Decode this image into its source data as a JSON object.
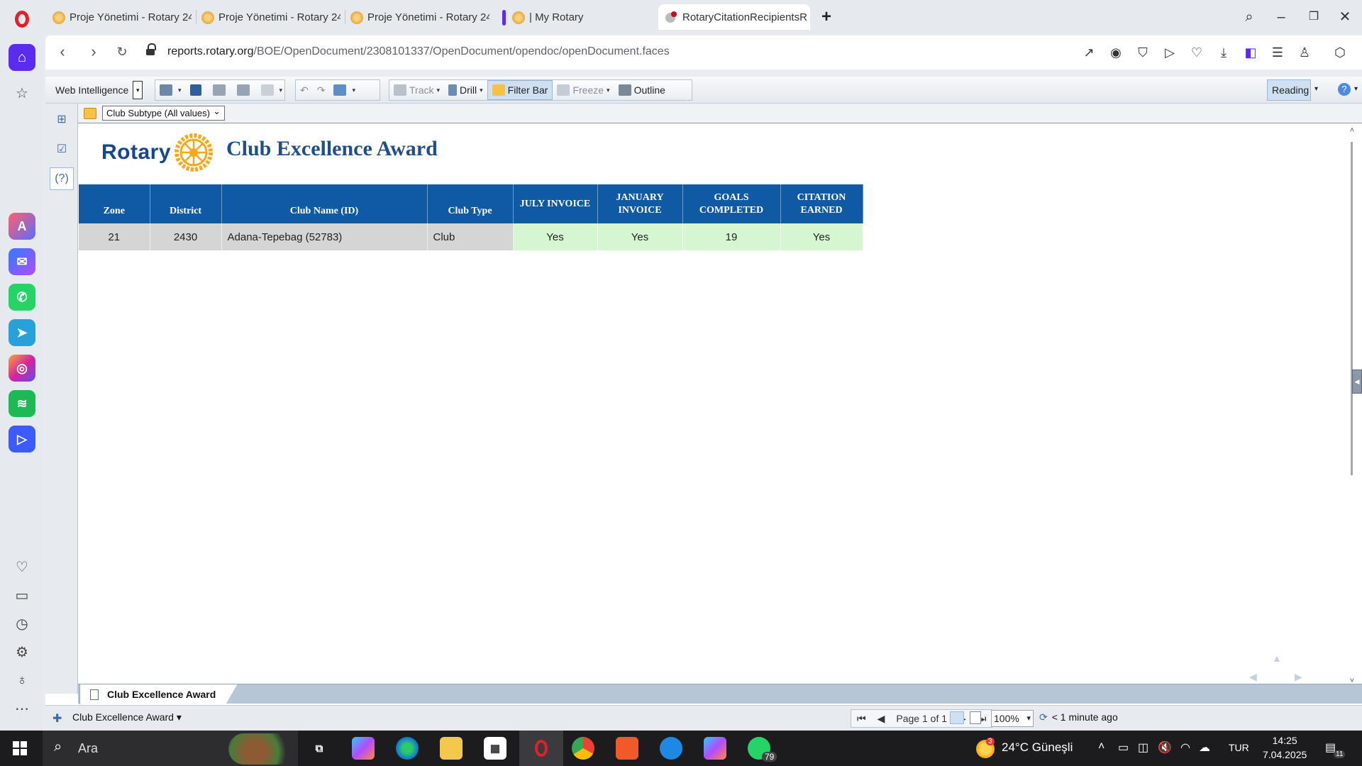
{
  "browser": {
    "tabs": [
      {
        "title": "Proje Yönetimi - Rotary 24"
      },
      {
        "title": "Proje Yönetimi - Rotary 24"
      },
      {
        "title": "Proje Yönetimi - Rotary 24"
      },
      {
        "title": "| My Rotary"
      },
      {
        "title": "RotaryCitationRecipientsR"
      }
    ],
    "url_host": "reports.rotary.org",
    "url_path": "/BOE/OpenDocument/2308101337/OpenDocument/opendoc/openDocument.faces"
  },
  "toolbar": {
    "app_name": "Web Intelligence",
    "track": "Track",
    "drill": "Drill",
    "filter_bar": "Filter Bar",
    "freeze": "Freeze",
    "outline": "Outline",
    "mode": "Reading"
  },
  "filter": {
    "label": "Club Subtype (All values)"
  },
  "report": {
    "logo_text": "Rotary",
    "title": "Club Excellence Award",
    "columns": [
      "Zone",
      "District",
      "Club Name (ID)",
      "Club Type",
      "JULY INVOICE",
      "JANUARY INVOICE",
      "GOALS COMPLETED",
      "CITATION EARNED"
    ],
    "rows": [
      {
        "zone": "21",
        "district": "2430",
        "club_name": "Adana-Tepebag (52783)",
        "club_type": "Club",
        "july_invoice": "Yes",
        "january_invoice": "Yes",
        "goals_completed": "19",
        "citation_earned": "Yes"
      }
    ]
  },
  "sheet_tab": "Club Excellence Award",
  "status": {
    "report_name": "Club Excellence Award",
    "page": "Page 1 of 1",
    "zoom": "100%",
    "refresh": "< 1 minute ago"
  },
  "taskbar": {
    "search": "Ara",
    "whatsapp_badge": "79",
    "weather": "24°C  Güneşli",
    "language": "TUR",
    "time": "14:25",
    "date": "7.04.2025",
    "notifications": "11",
    "weather_badge": "3"
  },
  "colors": {
    "header_blue": "#0f5aa3",
    "green_cell": "#d4f7cf",
    "grey_cell": "#d5d5d6",
    "brand_purple": "#5a2cf0",
    "rotary_blue": "#17458f",
    "rotary_gold": "#f7a81b"
  }
}
